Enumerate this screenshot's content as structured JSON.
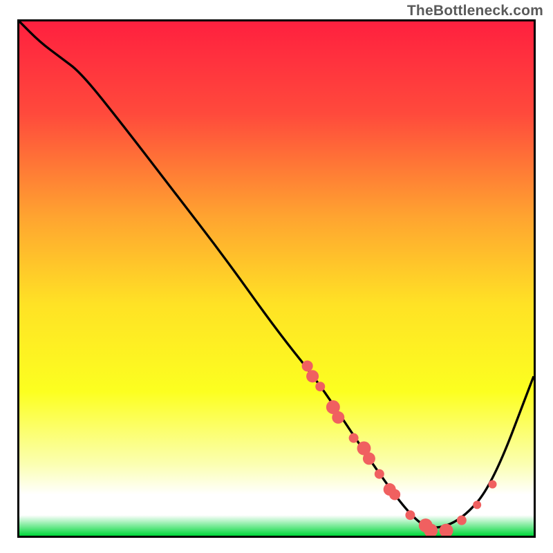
{
  "watermark": "TheBottleneck.com",
  "chart_data": {
    "type": "line",
    "title": "",
    "xlabel": "",
    "ylabel": "",
    "xlim": [
      0,
      100
    ],
    "ylim": [
      0,
      100
    ],
    "gradient_stops": [
      {
        "offset": 0,
        "color": "#ff203f"
      },
      {
        "offset": 18,
        "color": "#ff4a3c"
      },
      {
        "offset": 38,
        "color": "#ffa430"
      },
      {
        "offset": 55,
        "color": "#ffe225"
      },
      {
        "offset": 72,
        "color": "#fcff20"
      },
      {
        "offset": 86,
        "color": "#fbffb0"
      },
      {
        "offset": 92,
        "color": "#ffffff"
      },
      {
        "offset": 96,
        "color": "#ffffff"
      },
      {
        "offset": 100,
        "color": "#00d83a"
      }
    ],
    "series": [
      {
        "name": "bottleneck-curve",
        "color": "#000000",
        "x": [
          0,
          4,
          8,
          12,
          20,
          30,
          40,
          50,
          58,
          64,
          70,
          76,
          80,
          86,
          92,
          100
        ],
        "y": [
          100,
          96,
          93,
          90,
          80,
          67,
          54,
          40,
          30,
          21,
          12,
          4,
          1,
          3,
          10,
          31
        ]
      }
    ],
    "scatter_points": {
      "name": "highlight-dots",
      "color": "#f06060",
      "radius_small": 6,
      "radius_large": 11,
      "points": [
        {
          "x": 56,
          "y": 33,
          "r": 8
        },
        {
          "x": 57,
          "y": 31,
          "r": 9
        },
        {
          "x": 58.5,
          "y": 29,
          "r": 7
        },
        {
          "x": 61,
          "y": 25,
          "r": 10
        },
        {
          "x": 62,
          "y": 23,
          "r": 9
        },
        {
          "x": 65,
          "y": 19,
          "r": 7
        },
        {
          "x": 67,
          "y": 17,
          "r": 10
        },
        {
          "x": 68,
          "y": 15,
          "r": 9
        },
        {
          "x": 70,
          "y": 12,
          "r": 7
        },
        {
          "x": 72,
          "y": 9,
          "r": 9
        },
        {
          "x": 73,
          "y": 8,
          "r": 8
        },
        {
          "x": 76,
          "y": 4,
          "r": 7
        },
        {
          "x": 79,
          "y": 2,
          "r": 10
        },
        {
          "x": 80,
          "y": 1,
          "r": 10
        },
        {
          "x": 83,
          "y": 1,
          "r": 10
        },
        {
          "x": 86,
          "y": 3,
          "r": 7
        },
        {
          "x": 89,
          "y": 6,
          "r": 6
        },
        {
          "x": 92,
          "y": 10,
          "r": 6
        }
      ]
    }
  }
}
